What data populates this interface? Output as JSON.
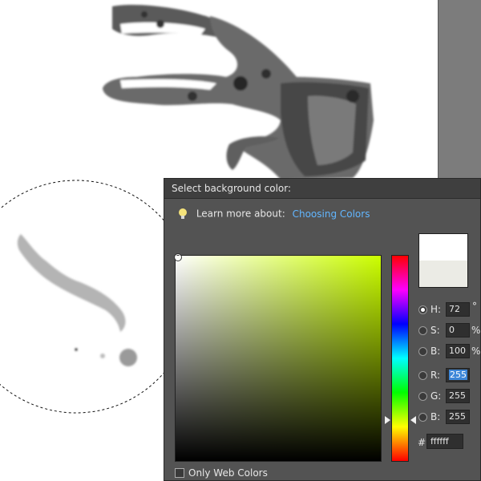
{
  "dialog": {
    "title": "Select background color:",
    "learn_prefix": "Learn more about:",
    "learn_link": "Choosing Colors",
    "fields": {
      "h": {
        "label": "H:",
        "value": "72",
        "unit": "°",
        "selected": true
      },
      "s": {
        "label": "S:",
        "value": "0",
        "unit": "%"
      },
      "b_hsb": {
        "label": "B:",
        "value": "100",
        "unit": "%"
      },
      "r": {
        "label": "R:",
        "value": "255"
      },
      "g": {
        "label": "G:",
        "value": "255"
      },
      "b_rgb": {
        "label": "B:",
        "value": "255"
      }
    },
    "hex": {
      "label": "#",
      "value": "ffffff"
    },
    "only_web_colors": {
      "label": "Only Web Colors",
      "checked": false
    },
    "swatch": {
      "new_color": "#ffffff",
      "current_color": "#ebebe5"
    },
    "field_base_hue_color": "#ccff00"
  },
  "colors": {
    "dialog_bg": "#535353",
    "titlebar_bg": "#3f3f3f",
    "link": "#62b6ff",
    "selection": "#3d87d8"
  }
}
